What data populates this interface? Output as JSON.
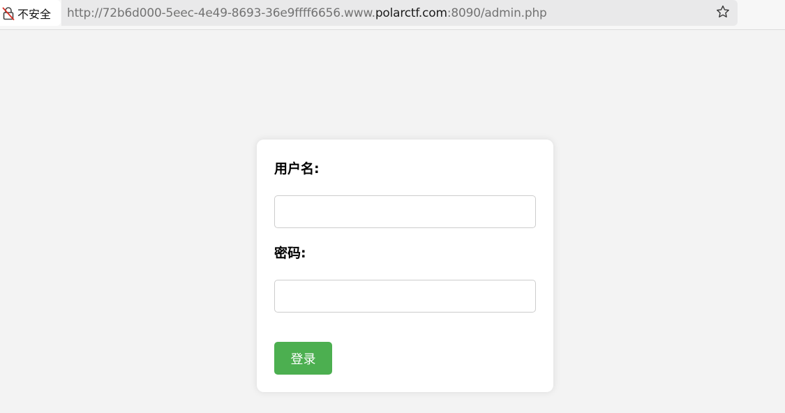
{
  "browser": {
    "security_label": "不安全",
    "url": {
      "prefix": "http://72b6d000-5eec-4e49-8693-36e9ffff6656.www.",
      "host": "polarctf.com",
      "suffix": ":8090/admin.php"
    },
    "security_icon": "insecure-lock-icon",
    "bookmark_icon": "star-outline-icon"
  },
  "login_form": {
    "username_label": "用户名:",
    "username_value": "",
    "password_label": "密码:",
    "password_value": "",
    "submit_label": "登录"
  },
  "colors": {
    "page_background": "#f3f3f3",
    "card_background": "#ffffff",
    "submit_button": "#4caf50",
    "insecure_icon_accent": "#d93025"
  }
}
